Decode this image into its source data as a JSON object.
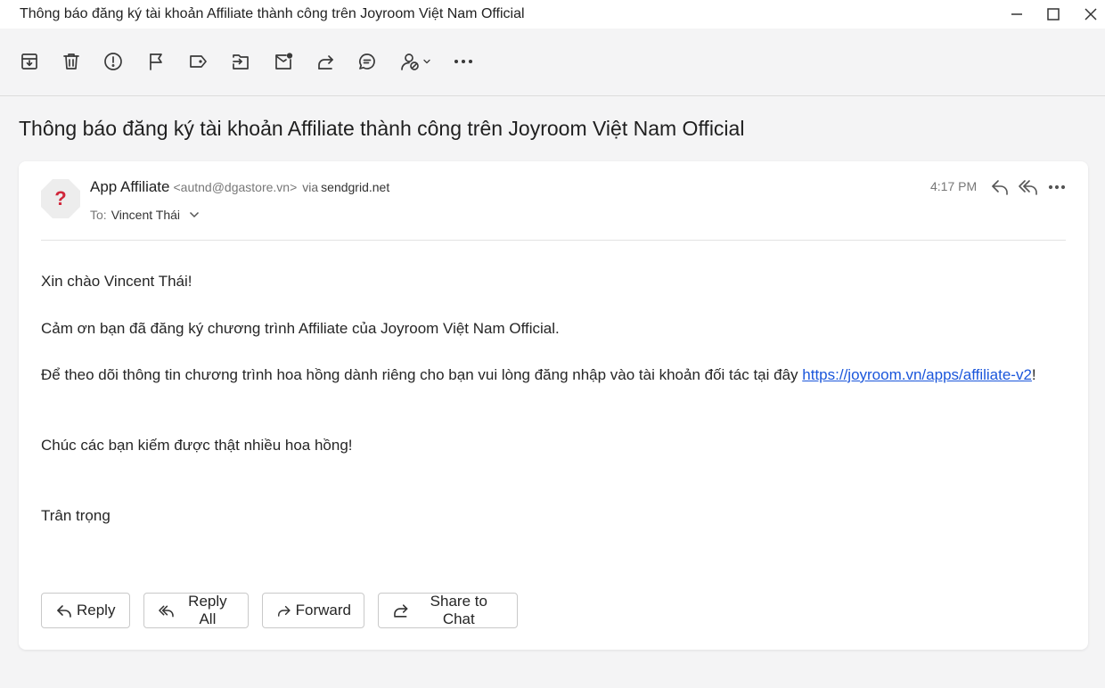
{
  "window": {
    "title": "Thông báo đăng ký tài khoản Affiliate thành công trên Joyroom Việt Nam Official"
  },
  "toolbar": {
    "icons": [
      "archive-icon",
      "delete-icon",
      "report-icon",
      "flag-icon",
      "label-icon",
      "move-icon",
      "mark-unread-icon",
      "forward-icon",
      "comment-icon",
      "block-sender-icon",
      "more-icon"
    ]
  },
  "message": {
    "subject": "Thông báo đăng ký tài khoản Affiliate thành công trên Joyroom Việt Nam Official",
    "sender_name": "App Affiliate",
    "sender_email": "<autnd@dgastore.vn>",
    "via_label": "via",
    "via_domain": "sendgrid.net",
    "to_label": "To:",
    "to_name": "Vincent Thái",
    "time": "4:17 PM",
    "avatar_glyph": "?"
  },
  "body": {
    "greeting": "Xin chào Vincent Thái!",
    "thanks": "Cảm ơn bạn đã đăng ký chương trình Affiliate của Joyroom Việt Nam Official.",
    "instruction": "Để theo dõi thông tin chương trình hoa hồng dành riêng cho bạn vui lòng đăng nhập vào tài khoản đối tác tại đây ",
    "link": "https://joyroom.vn/apps/affiliate-v2",
    "instruction_end": "!",
    "wish": "Chúc các bạn kiếm được thật nhiều hoa hồng!",
    "signoff": "Trân trọng"
  },
  "actions": {
    "reply": "Reply",
    "reply_all": "Reply All",
    "forward": "Forward",
    "share_to_chat": "Share to Chat"
  },
  "colors": {
    "link": "#1a56db",
    "avatar_mark": "#d0263a"
  }
}
